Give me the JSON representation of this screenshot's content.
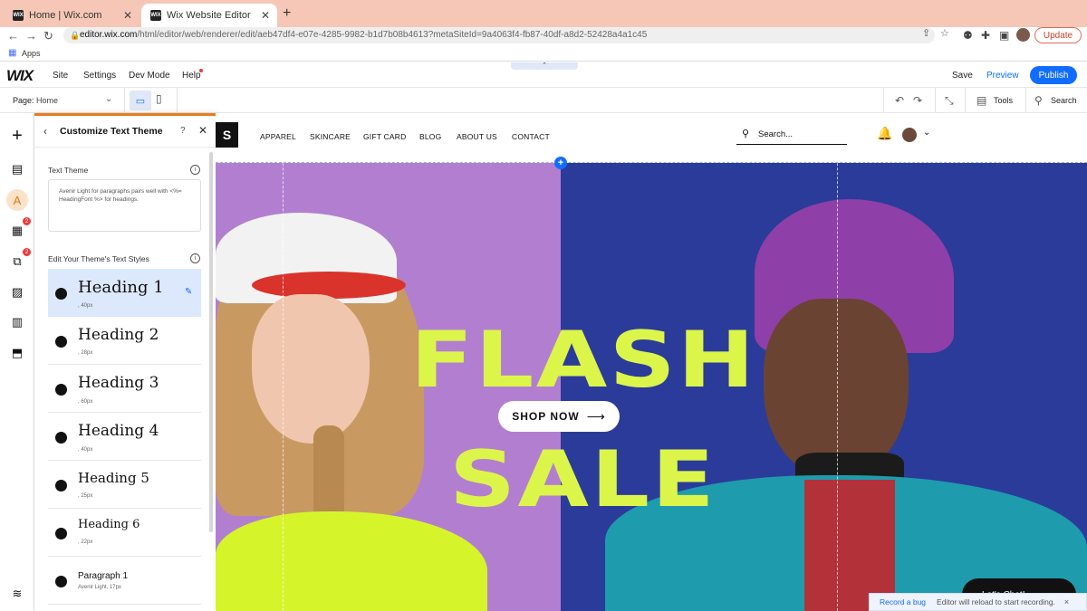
{
  "browser": {
    "tabs": [
      {
        "title": "Home | Wix.com",
        "favicon": "WIX"
      },
      {
        "title": "Wix Website Editor",
        "favicon": "WIX"
      }
    ],
    "new_tab": "+",
    "url_host": "editor.wix.com",
    "url_path": "/html/editor/web/renderer/edit/aeb47df4-e07e-4285-9982-b1d7b08b4613?metaSiteId=9a4063f4-fb87-40df-a8d2-52428a4a1c45",
    "update_label": "Update",
    "bookmarks_apps": "Apps"
  },
  "editor": {
    "logo": "WIX",
    "menu": [
      "Site",
      "Settings",
      "Dev Mode",
      "Help"
    ],
    "save_label": "Save",
    "preview_label": "Preview",
    "publish_label": "Publish",
    "page_label": "Page:",
    "page_value": "Home",
    "tools_label": "Tools",
    "search_label": "Search",
    "rail_badges": [
      "2",
      "2"
    ]
  },
  "panel": {
    "title": "Customize Text Theme",
    "help": "?",
    "text_theme_label": "Text Theme",
    "text_theme_desc": "Avenir Light for paragraphs pairs well with <%= HeadingFont %> for headings.",
    "styles_label": "Edit Your Theme's Text Styles",
    "styles": [
      {
        "name": "Heading 1",
        "meta": ", 40px"
      },
      {
        "name": "Heading 2",
        "meta": ", 28px"
      },
      {
        "name": "Heading 3",
        "meta": ", 60px"
      },
      {
        "name": "Heading 4",
        "meta": ", 40px"
      },
      {
        "name": "Heading 5",
        "meta": ", 25px"
      },
      {
        "name": "Heading 6",
        "meta": ", 22px"
      },
      {
        "name": "Paragraph 1",
        "meta": "Avenir Light, 17px"
      }
    ]
  },
  "site": {
    "logo_text": "S",
    "nav": [
      "APPAREL",
      "SKINCARE",
      "GIFT CARD",
      "BLOG",
      "ABOUT US",
      "CONTACT"
    ],
    "search_placeholder": "Search...",
    "hero_line1": "FLASH",
    "hero_line2": "SALE",
    "cta_label": "SHOP NOW",
    "cta_arrow": "⟶",
    "chat_label": "Let's Chat!"
  },
  "record_bar": {
    "link": "Record a bug",
    "message": "Editor will reload to start recording.",
    "close": "×"
  },
  "colors": {
    "accent": "#116dff",
    "panel_accent": "#e97c21",
    "hero_text": "#dcf54a",
    "hero_left_bg": "#b27fd0",
    "hero_right_bg": "#2b3b9a"
  }
}
